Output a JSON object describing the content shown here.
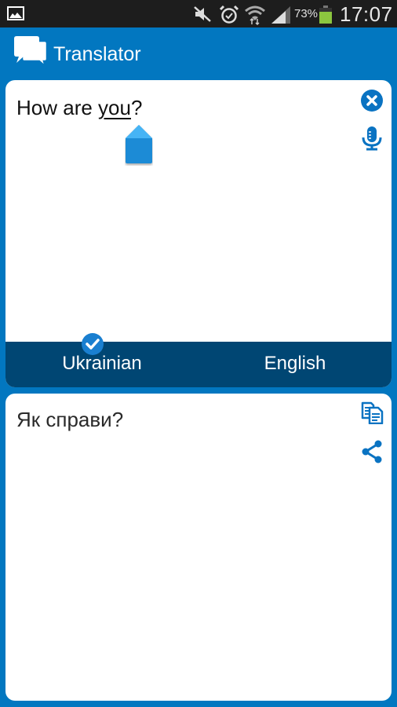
{
  "status_bar": {
    "icons": [
      "gallery-icon",
      "mute-icon",
      "alarm-icon",
      "wifi-icon",
      "signal-icon"
    ],
    "battery_percent_label": "73%",
    "battery_level": 0.73,
    "time": "17:07"
  },
  "app_bar": {
    "title": "Translator",
    "logo_icon": "chat-bubbles-icon"
  },
  "input_panel": {
    "text_before": "How are ",
    "text_underlined": "you",
    "text_after": "?",
    "actions": [
      {
        "name": "clear",
        "icon": "close-circle-icon"
      },
      {
        "name": "voice-input",
        "icon": "microphone-icon"
      }
    ]
  },
  "language_bar": {
    "source_language": "Ukrainian",
    "target_language": "English",
    "selected": "Ukrainian",
    "selected_icon": "check-circle-icon"
  },
  "output_panel": {
    "text": "Як справи?",
    "actions": [
      {
        "name": "copy",
        "icon": "copy-icon"
      },
      {
        "name": "share",
        "icon": "share-icon"
      }
    ]
  },
  "colors": {
    "primary": "#0277c0",
    "language_bar": "#004673",
    "accent_icon": "#0a73c2",
    "status_bar": "#1d1d1d",
    "battery": "#8cc63f"
  }
}
